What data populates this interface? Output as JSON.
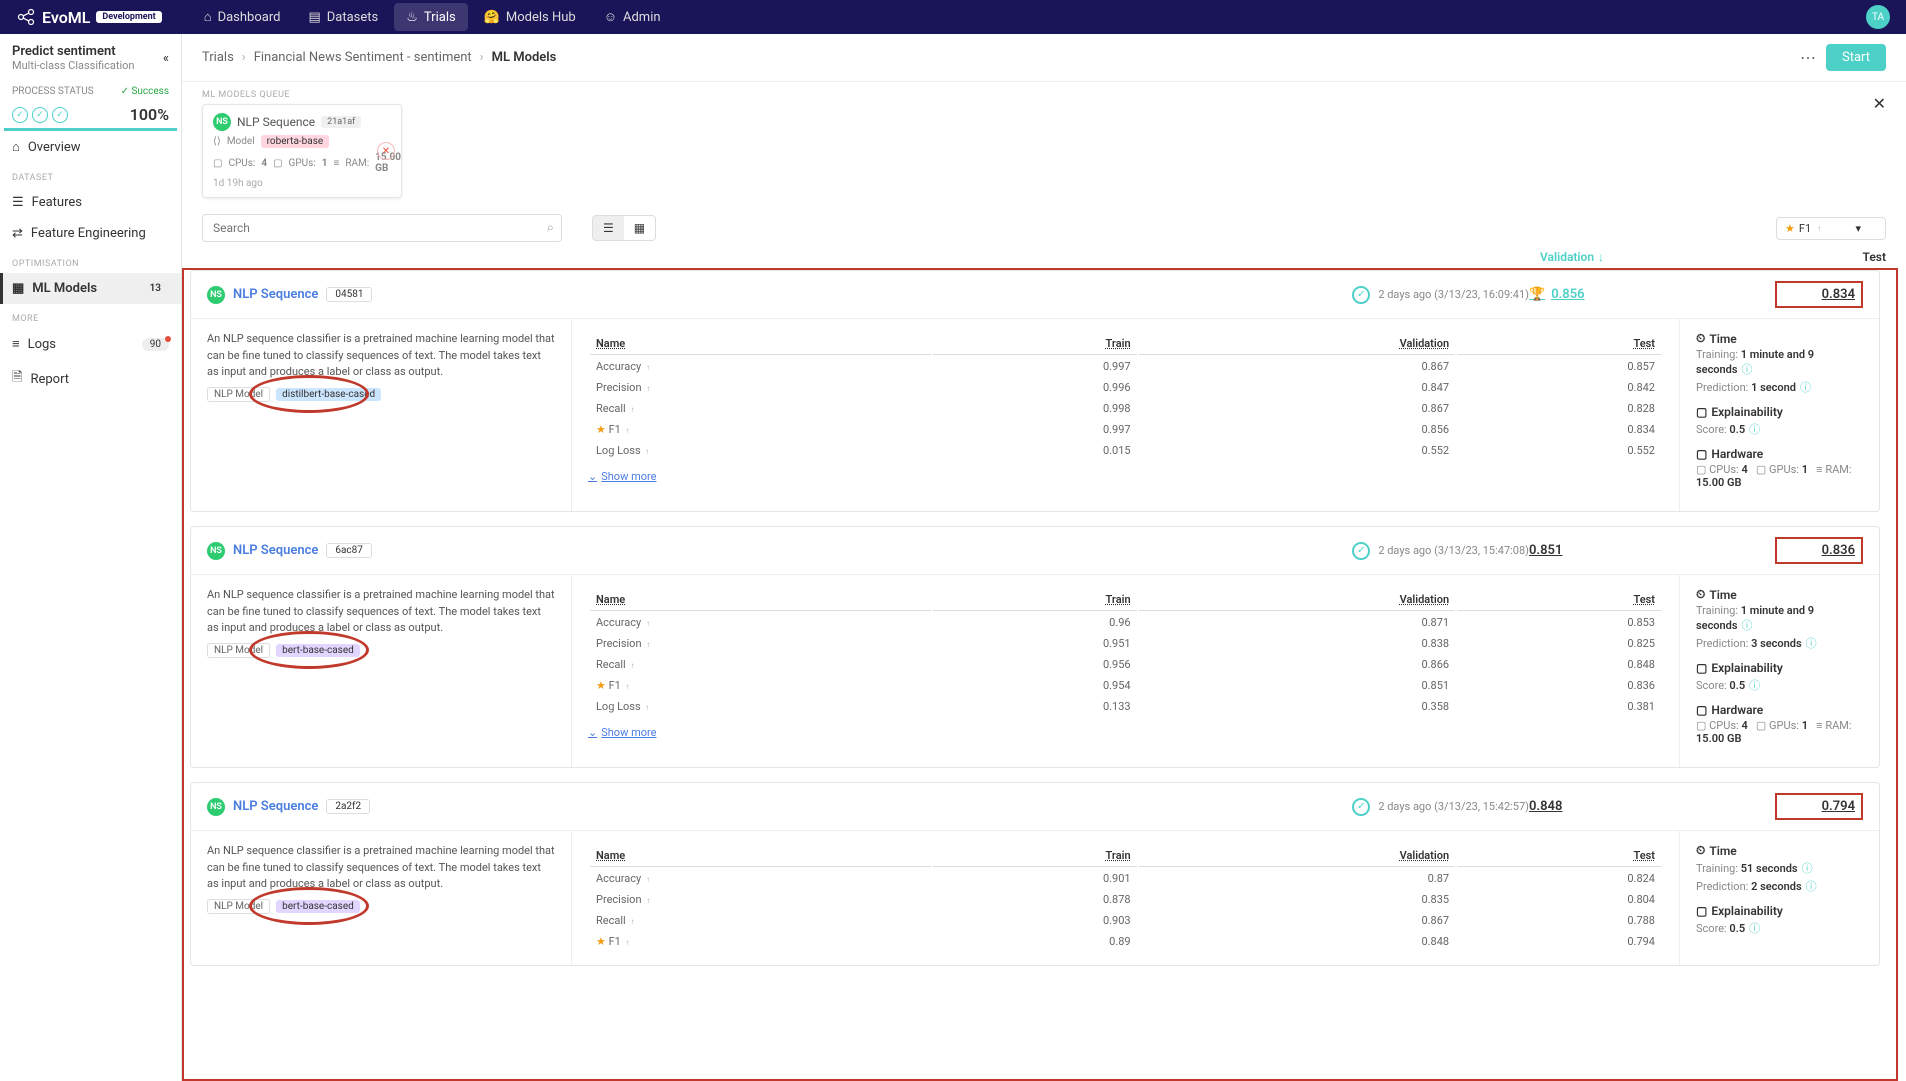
{
  "brand": {
    "name": "EvoML",
    "badge": "Development"
  },
  "nav": [
    {
      "label": "Dashboard"
    },
    {
      "label": "Datasets"
    },
    {
      "label": "Trials"
    },
    {
      "label": "Models Hub"
    },
    {
      "label": "Admin"
    }
  ],
  "avatar": "TA",
  "sidebar": {
    "title": "Predict sentiment",
    "subtitle": "Multi-class Classification",
    "process_status_label": "PROCESS STATUS",
    "success_label": "Success",
    "percent": "100%",
    "sections": {
      "dataset_label": "DATASET",
      "optimisation_label": "OPTIMISATION",
      "more_label": "MORE"
    },
    "items": {
      "overview": "Overview",
      "features": "Features",
      "feature_eng": "Feature Engineering",
      "ml_models": "ML Models",
      "ml_models_badge": "13",
      "logs": "Logs",
      "logs_badge": "90",
      "report": "Report"
    }
  },
  "breadcrumb": {
    "c1": "Trials",
    "c2": "Financial News Sentiment - sentiment",
    "c3": "ML Models",
    "start": "Start"
  },
  "queue": {
    "label": "ML MODELS QUEUE",
    "title": "NLP Sequence",
    "hash": "21a1af",
    "model_label": "Model",
    "model_name": "roberta-base",
    "cpus_label": "CPUs:",
    "cpus": "4",
    "gpus_label": "GPUs:",
    "gpus": "1",
    "ram_label": "RAM:",
    "ram": "15.00 GB",
    "time": "1d 19h ago"
  },
  "toolbar": {
    "search_placeholder": "Search",
    "sort_label": "F1",
    "val_header": "Validation",
    "test_header": "Test"
  },
  "metrics_headers": {
    "name": "Name",
    "train": "Train",
    "validation": "Validation",
    "test": "Test"
  },
  "desc_text": "An NLP sequence classifier is a pretrained machine learning model that can be fine tuned to classify sequences of text. The model takes text as input and produces a label or class as output.",
  "nlp_model_label": "NLP Model",
  "show_more": "Show more",
  "info_labels": {
    "time": "Time",
    "training": "Training:",
    "prediction": "Prediction:",
    "explainability": "Explainability",
    "score": "Score:",
    "hardware": "Hardware",
    "cpus": "CPUs:",
    "gpus": "GPUs:",
    "ram": "RAM:"
  },
  "models": [
    {
      "title": "NLP Sequence",
      "hash": "04581",
      "timestamp": "2 days ago (3/13/23, 16:09:41)",
      "val": "0.856",
      "test": "0.834",
      "trophy": true,
      "model_pill": "distilbert-base-cased",
      "pill_class": "blue",
      "metrics": [
        {
          "name": "Accuracy",
          "train": "0.997",
          "val": "0.867",
          "test": "0.857"
        },
        {
          "name": "Precision",
          "train": "0.996",
          "val": "0.847",
          "test": "0.842"
        },
        {
          "name": "Recall",
          "train": "0.998",
          "val": "0.867",
          "test": "0.828"
        },
        {
          "name": "F1",
          "train": "0.997",
          "val": "0.856",
          "test": "0.834",
          "star": true
        },
        {
          "name": "Log Loss",
          "train": "0.015",
          "val": "0.552",
          "test": "0.552"
        }
      ],
      "training": "1 minute and 9 seconds",
      "prediction": "1 second",
      "score": "0.5",
      "cpus": "4",
      "gpus": "1",
      "ram": "15.00 GB"
    },
    {
      "title": "NLP Sequence",
      "hash": "6ac87",
      "timestamp": "2 days ago (3/13/23, 15:47:08)",
      "val": "0.851",
      "test": "0.836",
      "trophy": false,
      "model_pill": "bert-base-cased",
      "pill_class": "purple",
      "metrics": [
        {
          "name": "Accuracy",
          "train": "0.96",
          "val": "0.871",
          "test": "0.853"
        },
        {
          "name": "Precision",
          "train": "0.951",
          "val": "0.838",
          "test": "0.825"
        },
        {
          "name": "Recall",
          "train": "0.956",
          "val": "0.866",
          "test": "0.848"
        },
        {
          "name": "F1",
          "train": "0.954",
          "val": "0.851",
          "test": "0.836",
          "star": true
        },
        {
          "name": "Log Loss",
          "train": "0.133",
          "val": "0.358",
          "test": "0.381"
        }
      ],
      "training": "1 minute and 9 seconds",
      "prediction": "3 seconds",
      "score": "0.5",
      "cpus": "4",
      "gpus": "1",
      "ram": "15.00 GB"
    },
    {
      "title": "NLP Sequence",
      "hash": "2a2f2",
      "timestamp": "2 days ago (3/13/23, 15:42:57)",
      "val": "0.848",
      "test": "0.794",
      "trophy": false,
      "model_pill": "bert-base-cased",
      "pill_class": "purple",
      "metrics": [
        {
          "name": "Accuracy",
          "train": "0.901",
          "val": "0.87",
          "test": "0.824"
        },
        {
          "name": "Precision",
          "train": "0.878",
          "val": "0.835",
          "test": "0.804"
        },
        {
          "name": "Recall",
          "train": "0.903",
          "val": "0.867",
          "test": "0.788"
        },
        {
          "name": "F1",
          "train": "0.89",
          "val": "0.848",
          "test": "0.794",
          "star": true
        }
      ],
      "training": "51 seconds",
      "prediction": "2 seconds",
      "score": "0.5"
    }
  ]
}
